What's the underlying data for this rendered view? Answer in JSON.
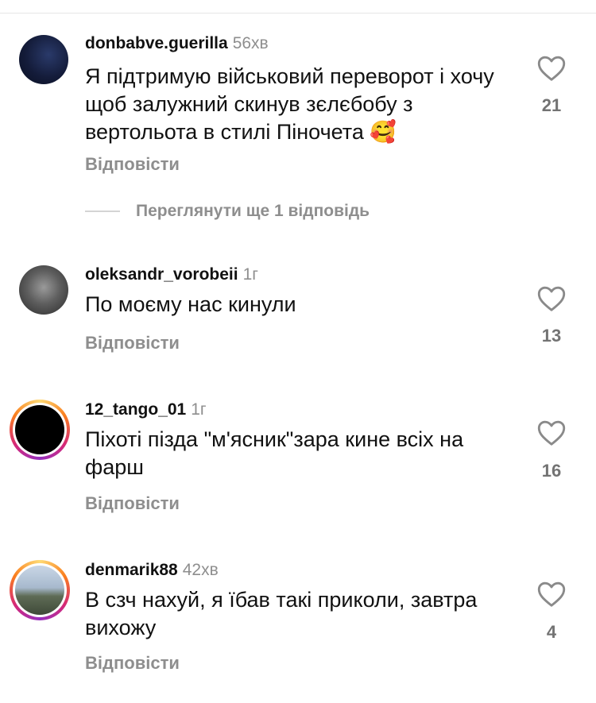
{
  "comments": [
    {
      "username": "donbabve.guerilla",
      "time": "56хв",
      "text": "Я підтримую військовий переворот і хочу щоб залужний скинув зєлєбобу з вертольота в стилі Піночета 🥰",
      "reply": "Відповісти",
      "likes": "21",
      "avatar_ring": false
    },
    {
      "username": "oleksandr_vorobeii",
      "time": "1г",
      "text": "По моєму нас кинули",
      "reply": "Відповісти",
      "likes": "13",
      "avatar_ring": false
    },
    {
      "username": "12_tango_01",
      "time": "1г",
      "text": "Піхоті пізда \"м'ясник\"зара кине всіх на фарш",
      "reply": "Відповісти",
      "likes": "16",
      "avatar_ring": true
    },
    {
      "username": "denmarik88",
      "time": "42хв",
      "text": "В сзч нахуй, я їбав такі приколи, завтра вихожу",
      "reply": "Відповісти",
      "likes": "4",
      "avatar_ring": true
    }
  ],
  "view_more_replies": "Переглянути ще 1 відповідь",
  "icons": {
    "like": "heart-outline-icon"
  },
  "colors": {
    "muted": "#8e8e8e",
    "ring_gradient": [
      "#feda75",
      "#fa7e1e",
      "#d62976",
      "#962fbf"
    ]
  }
}
